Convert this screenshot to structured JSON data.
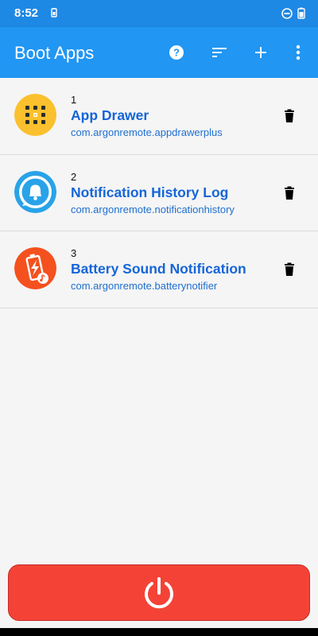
{
  "status": {
    "time": "8:52",
    "icons": [
      "battery-saver-icon",
      "do-not-disturb-icon",
      "battery-icon"
    ]
  },
  "app_bar": {
    "title": "Boot Apps",
    "actions": [
      "help-icon",
      "sort-icon",
      "add-icon",
      "more-icon"
    ]
  },
  "apps": [
    {
      "number": "1",
      "name": "App Drawer",
      "package": "com.argonremote.appdrawerplus",
      "icon": "app-drawer-icon",
      "icon_color": "#fbc02d"
    },
    {
      "number": "2",
      "name": "Notification History Log",
      "package": "com.argonremote.notificationhistory",
      "icon": "notification-bell-icon",
      "icon_color": "#29a3e8"
    },
    {
      "number": "3",
      "name": "Battery Sound Notification",
      "package": "com.argonremote.batterynotifier",
      "icon": "battery-sound-icon",
      "icon_color": "#f4511e"
    }
  ],
  "colors": {
    "status_bar": "#1e88e5",
    "app_bar": "#2196f3",
    "link_blue": "#1565d8",
    "power_red": "#f44336"
  },
  "power": {
    "icon": "power-icon"
  }
}
